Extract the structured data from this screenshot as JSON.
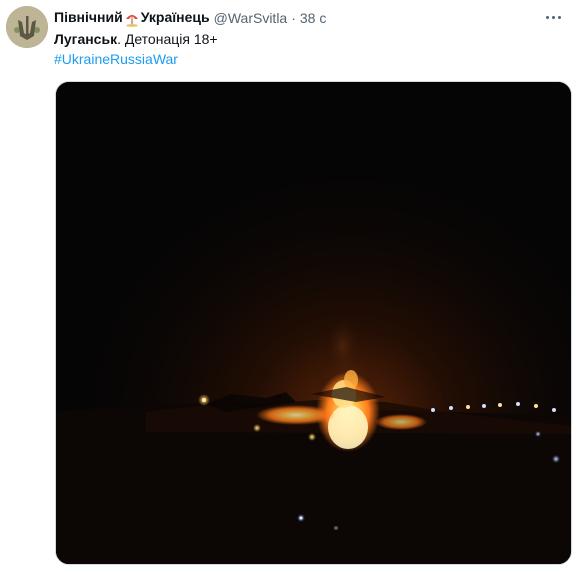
{
  "tweet": {
    "display_name_part1": "Північний",
    "display_name_emoji": "umbrella-on-ground-icon",
    "display_name_part2": "Українець",
    "handle": "@WarSvitla",
    "dot": "·",
    "time": "38 с",
    "text_bold": "Луганськ",
    "text_rest": ". Детонація 18+",
    "hashtag": "#UkraineRussiaWar",
    "media": {
      "type": "video",
      "description_icon": "night-explosion-video"
    }
  },
  "colors": {
    "text": "#0f1419",
    "secondary": "#536471",
    "link": "#1d9bf0",
    "media_bg": "#060505",
    "fire_core": "#fff4c0",
    "fire_orange": "#ff7a1a"
  }
}
